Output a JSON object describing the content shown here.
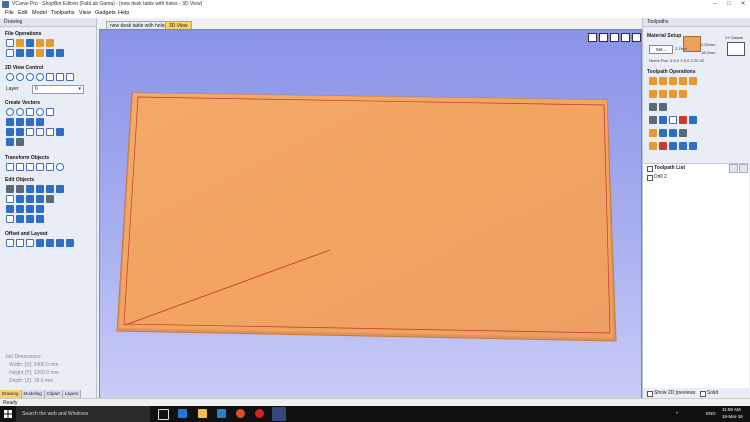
{
  "window": {
    "title": "VCarve Pro - ShopBot Edition (FabLab Gama) - [new desk table with holes - 3D View]"
  },
  "menu": [
    "File",
    "Edit",
    "Model",
    "Toolpaths",
    "View",
    "Gadgets",
    "Help"
  ],
  "left_panel": {
    "header": "Drawing",
    "sections": [
      "File Operations",
      "2D View Control",
      "Create Vectors",
      "Transform Objects",
      "Edit Objects",
      "Offset and Layout"
    ],
    "layer_label": "Layer",
    "layer_value": "0",
    "job_dimensions": {
      "title": "Job Dimensions:",
      "width": "Width: [X]: 2400.0 mm",
      "height": "Height [Y]: 1200.0 mm",
      "depth": "Depth: [Z]: 18.0 mm"
    },
    "tabs": [
      "Drawing",
      "Modeling",
      "Clipart",
      "Layers"
    ]
  },
  "view": {
    "tabs": [
      "new desk table with holes",
      "3D View"
    ],
    "active_tab": 1
  },
  "right_panel": {
    "header": "Toolpaths",
    "material_setup": "Material Setup",
    "set_button": "Set...",
    "xy_datum": "XY Datum",
    "z_zero": "Z Zero",
    "thickness": "18.0mm",
    "offset": "0.00mm",
    "home_pos": "Home Pos: X:0.0 Y:0.0 Z:20.32",
    "toolpath_operations": "Toolpath Operations",
    "toolpath_list_label": "Toolpath List",
    "toolpaths": [
      "Drill 2"
    ],
    "show_2d_previews": "Show 2D previews",
    "solid": "Solid"
  },
  "statusbar": {
    "text": "Ready"
  },
  "taskbar": {
    "search_placeholder": "Search the web and Windows",
    "time": "11:59 AM",
    "date": "16-Mar-16",
    "lang": "ENG"
  },
  "colors": {
    "board": "#f2a460",
    "board_edge": "#d97f3c",
    "cut_line": "#c0392b",
    "background_top": "#8a93e6",
    "background_bottom": "#c9ccf6"
  }
}
